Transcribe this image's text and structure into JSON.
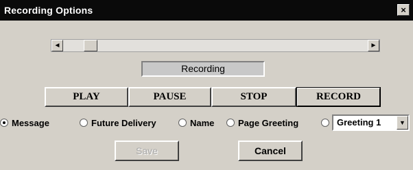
{
  "window": {
    "title": "Recording Options",
    "close_label": "×"
  },
  "scrollbar": {
    "left_arrow": "◄",
    "right_arrow": "►",
    "position_fraction": 0.07
  },
  "status_text": "Recording",
  "transport": {
    "play": "PLAY",
    "pause": "PAUSE",
    "stop": "STOP",
    "record": "RECORD"
  },
  "recording_type": {
    "options": [
      "Message",
      "Future Delivery",
      "Name",
      "Page Greeting",
      ""
    ],
    "selected": "Message"
  },
  "greeting_select": {
    "value": "Greeting 1",
    "arrow": "▼"
  },
  "actions": {
    "save": "Save",
    "save_enabled": false,
    "cancel": "Cancel"
  }
}
